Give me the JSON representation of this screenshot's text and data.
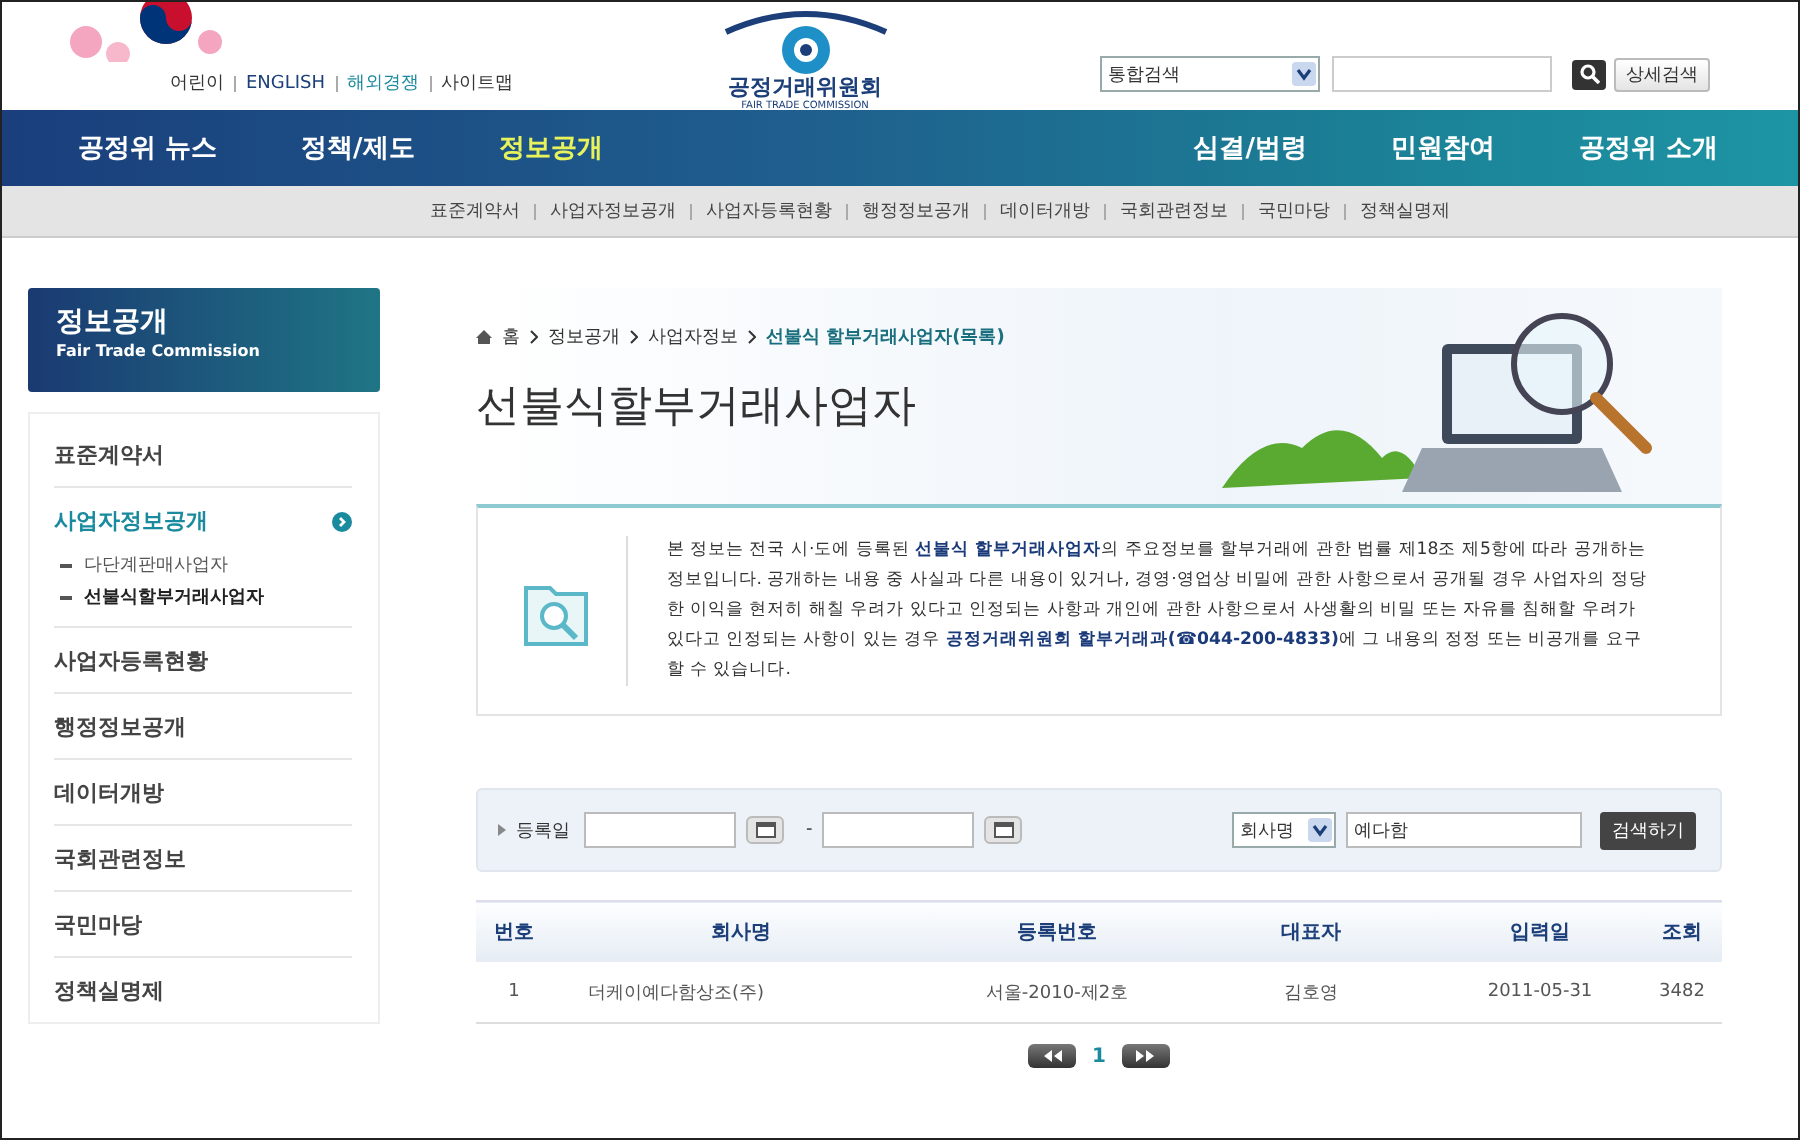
{
  "header": {
    "util_links": [
      "어린이",
      "ENGLISH",
      "해외경쟁",
      "사이트맵"
    ],
    "logo_name": "공정거래위원회",
    "logo_sub": "FAIR TRADE COMMISSION",
    "search_scope": "통합검색",
    "detail_search": "상세검색"
  },
  "nav": [
    {
      "label": "공정위 뉴스",
      "selected": false
    },
    {
      "label": "정책/제도",
      "selected": false
    },
    {
      "label": "정보공개",
      "selected": true
    },
    {
      "label": "심결/법령",
      "selected": false
    },
    {
      "label": "민원참여",
      "selected": false
    },
    {
      "label": "공정위 소개",
      "selected": false
    }
  ],
  "subnav": [
    "표준계약서",
    "사업자정보공개",
    "사업자등록현황",
    "행정정보공개",
    "데이터개방",
    "국회관련정보",
    "국민마당",
    "정책실명제"
  ],
  "sidebar": {
    "title": "정보공개",
    "subtitle": "Fair Trade Commission",
    "items": [
      {
        "label": "표준계약서",
        "selected": false
      },
      {
        "label": "사업자정보공개",
        "selected": true,
        "children": [
          {
            "label": "다단계판매사업자",
            "selected": false
          },
          {
            "label": "선불식할부거래사업자",
            "selected": true
          }
        ]
      },
      {
        "label": "사업자등록현황",
        "selected": false
      },
      {
        "label": "행정정보공개",
        "selected": false
      },
      {
        "label": "데이터개방",
        "selected": false
      },
      {
        "label": "국회관련정보",
        "selected": false
      },
      {
        "label": "국민마당",
        "selected": false
      },
      {
        "label": "정책실명제",
        "selected": false
      }
    ]
  },
  "breadcrumb": [
    "홈",
    "정보공개",
    "사업자정보",
    "선불식 할부거래사업자(목록)"
  ],
  "page_title": "선불식할부거래사업자",
  "notice": "본 정보는 전국 시·도에 등록된 **선불식 할부거래사업자**의 주요정보를 할부거래에 관한 법률 제18조 제5항에 따라 공개하는 정보입니다. 공개하는 내용 중 사실과 다른 내용이 있거나, 경영·영업상 비밀에 관한 사항으로서 공개될 경우 사업자의 정당한 이익을 현저히 해칠 우려가 있다고 인정되는 사항과 개인에 관한 사항으로서 사생활의 비밀 또는 자유를 침해할 우려가 있다고 인정되는 사항이 있는 경우 **공정거래위원회 할부거래과(☎044-200-4833)**에 그 내용의 정정 또는 비공개를 요구할 수 있습니다.",
  "search": {
    "date_label": "등록일",
    "date_separator": "-",
    "field": "회사명",
    "value": "예다함",
    "button": "검색하기"
  },
  "table": {
    "columns": [
      "번호",
      "회사명",
      "등록번호",
      "대표자",
      "입력일",
      "조회"
    ],
    "rows": [
      [
        "1",
        "더케이예다함상조(주)",
        "서울-2010-제2호",
        "김호영",
        "2011-05-31",
        "3482"
      ]
    ]
  },
  "pager": {
    "pages": [
      {
        "label": "1",
        "selected": true
      }
    ]
  }
}
